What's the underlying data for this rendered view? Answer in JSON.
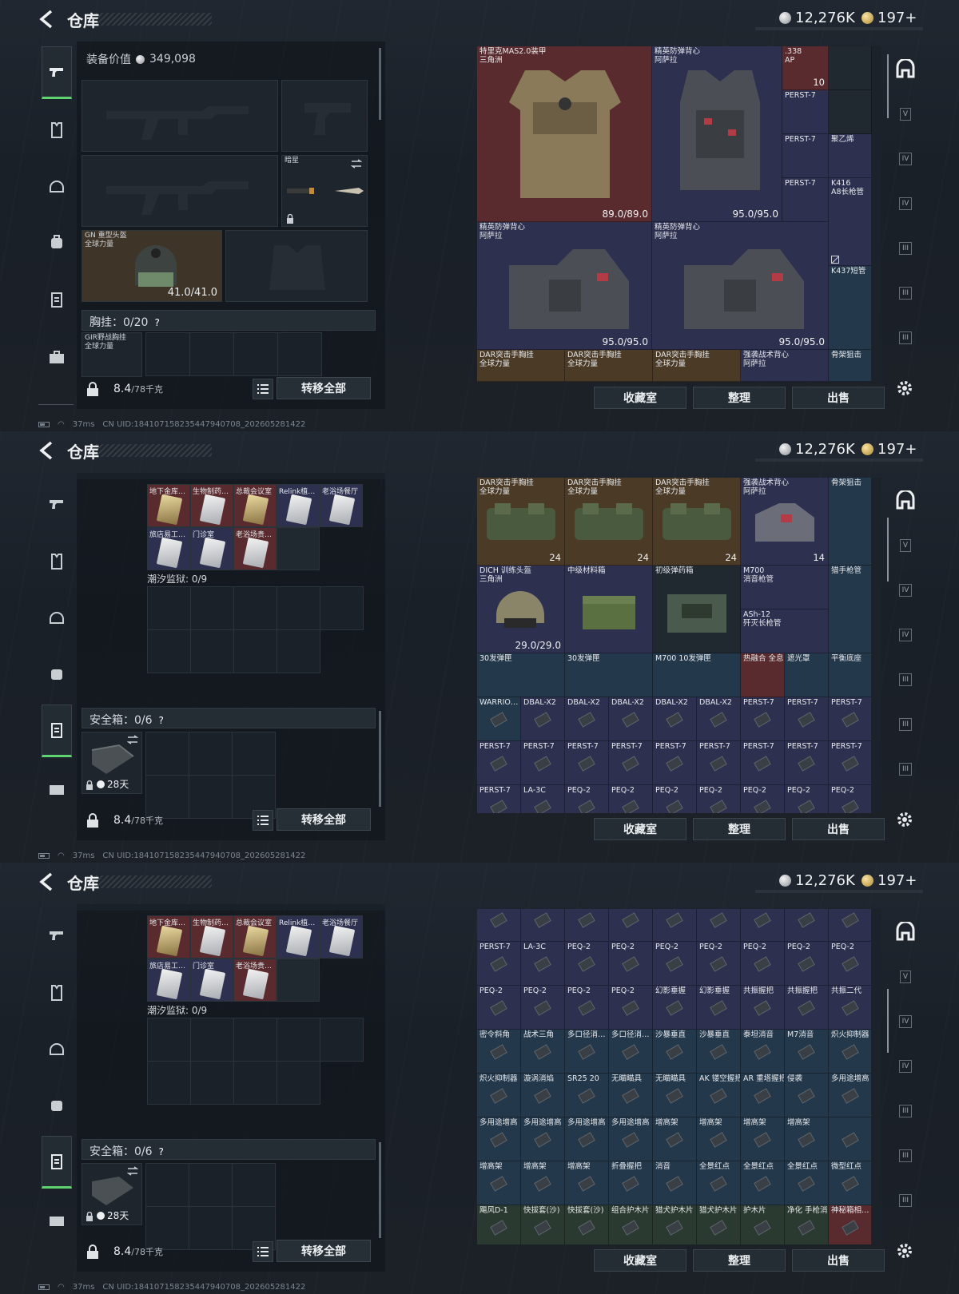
{
  "header": {
    "title": "仓库",
    "silver_amount": "12,276K",
    "gold_amount": "197+"
  },
  "left": {
    "equip_value_label": "装备价值",
    "equip_value": "349,098",
    "helmet_name": "GN 重型头盔",
    "helmet_sub": "全球力量",
    "helmet_dur": "41.0/41.0",
    "knife_name": "暗星",
    "chest_rig": "胸挂：0/20",
    "chest_rig_item": "GIR野战胸挂",
    "chest_rig_item_sub": "全球力量",
    "weight_value": "8.4",
    "weight_limit": "/78千克",
    "transfer_all": "转移全部",
    "tidal_prison": "潮汐监狱: 0/9",
    "safe_box": "安全箱：0/6",
    "safe_timer": "28天",
    "keycards_row1": [
      "地下金库…",
      "生物制药…",
      "总裁会议室",
      "Relink植…",
      "老浴场餐厅"
    ],
    "keycards_row2": [
      "旅店易工…",
      "门诊室",
      "老浴场贵…"
    ]
  },
  "right": {
    "btn_collection": "收藏室",
    "btn_sort": "整理",
    "btn_sell": "出售",
    "nav_badges": [
      "V",
      "IV",
      "IV",
      "III",
      "III",
      "III"
    ]
  },
  "frame1_items": [
    {
      "name": "特里克MAS2.0装甲",
      "sub": "三角洲",
      "dur": "89.0/89.0"
    },
    {
      "name": "精英防弹背心",
      "sub": "阿萨拉",
      "dur": "95.0/95.0"
    },
    {
      "name": ".338",
      "sub": "AP",
      "count": "10"
    },
    {
      "name": "PERST-7"
    },
    {
      "name": "PERST-7"
    },
    {
      "name": "聚乙烯"
    },
    {
      "name": "PERST-7"
    },
    {
      "name": "K416",
      "sub": "A8长枪管"
    },
    {
      "name": "精英防弹背心",
      "sub": "阿萨拉",
      "dur": "95.0/95.0"
    },
    {
      "name": "精英防弹背心",
      "sub": "阿萨拉",
      "dur": "95.0/95.0"
    },
    {
      "name": "K437短管"
    },
    {
      "name": "DAR突击手胸挂",
      "sub": "全球力量"
    },
    {
      "name": "DAR突击手胸挂",
      "sub": "全球力量"
    },
    {
      "name": "DAR突击手胸挂",
      "sub": "全球力量"
    },
    {
      "name": "强袭战术背心",
      "sub": "阿萨拉"
    },
    {
      "name": "骨架狙击"
    }
  ],
  "frame2_items": [
    {
      "name": "DAR突击手胸挂",
      "sub": "全球力量",
      "count": "24"
    },
    {
      "name": "DAR突击手胸挂",
      "sub": "全球力量",
      "count": "24"
    },
    {
      "name": "DAR突击手胸挂",
      "sub": "全球力量",
      "count": "24"
    },
    {
      "name": "强袭战术背心",
      "sub": "阿萨拉",
      "count": "14"
    },
    {
      "name": "骨架狙击"
    },
    {
      "name": "DICH 训练头盔",
      "sub": "三角洲",
      "dur": "29.0/29.0"
    },
    {
      "name": "中级材料箱"
    },
    {
      "name": "初级弹药箱"
    },
    {
      "name": "M700",
      "sub": "消音枪管"
    },
    {
      "name": "猎手枪管"
    },
    {
      "name": "ASh-12",
      "sub": "歼灭长枪管"
    },
    {
      "name": "30发弹匣"
    },
    {
      "name": "30发弹匣"
    },
    {
      "name": "M700 10发弹匣"
    },
    {
      "name": "热融合 全息"
    },
    {
      "name": "遮光罩"
    },
    {
      "name": "平衡底座"
    }
  ],
  "frame2_small_row1": [
    "WARRIO…",
    "DBAL-X2",
    "DBAL-X2",
    "DBAL-X2",
    "DBAL-X2",
    "DBAL-X2",
    "PERST-7",
    "PERST-7",
    "PERST-7"
  ],
  "frame2_small_row2": [
    "PERST-7",
    "PERST-7",
    "PERST-7",
    "PERST-7",
    "PERST-7",
    "PERST-7",
    "PERST-7",
    "PERST-7",
    "PERST-7"
  ],
  "frame2_small_row3": [
    "PERST-7",
    "LA-3C",
    "PEQ-2",
    "PEQ-2",
    "PEQ-2",
    "PEQ-2",
    "PEQ-2",
    "PEQ-2",
    "PEQ-2"
  ],
  "frame3_rows": [
    [
      "",
      "",
      "",
      "",
      "",
      "",
      "",
      "",
      ""
    ],
    [
      "PERST-7",
      "LA-3C",
      "PEQ-2",
      "PEQ-2",
      "PEQ-2",
      "PEQ-2",
      "PEQ-2",
      "PEQ-2",
      "PEQ-2"
    ],
    [
      "PEQ-2",
      "PEQ-2",
      "PEQ-2",
      "PEQ-2",
      "幻影垂握",
      "幻影垂握",
      "共振握把",
      "共振握把",
      "共振二代"
    ],
    [
      "密令斜角",
      "战术三角",
      "多口径消…",
      "多口径消…",
      "沙暴垂直",
      "沙暴垂直",
      "泰坦消音",
      "M7消音",
      "炽火抑制器"
    ],
    [
      "炽火抑制器",
      "漩涡消焰",
      "SR25 20",
      "无瞄瞄具",
      "无瞄瞄具",
      "AK 镂空握把",
      "AR 重塔握把",
      "侵袭",
      "多用途增高"
    ],
    [
      "多用途增高",
      "多用途增高",
      "多用途增高",
      "多用途增高",
      "增高架",
      "增高架",
      "增高架",
      "增高架",
      ""
    ],
    [
      "增高架",
      "增高架",
      "增高架",
      "折叠握把",
      "消音",
      "全景红点",
      "全景红点",
      "全景红点",
      "微型红点"
    ],
    [
      "飓风D-1",
      "快拔套(沙)",
      "快拔套(沙)",
      "组合护木片",
      "猎犬护木片",
      "猎犬护木片",
      "护木片",
      "净化 手枪消音",
      "神秘箱相…"
    ]
  ],
  "status": {
    "ping": "37ms",
    "uid": "CN UID:18410715823544794070­8_202605281422"
  }
}
